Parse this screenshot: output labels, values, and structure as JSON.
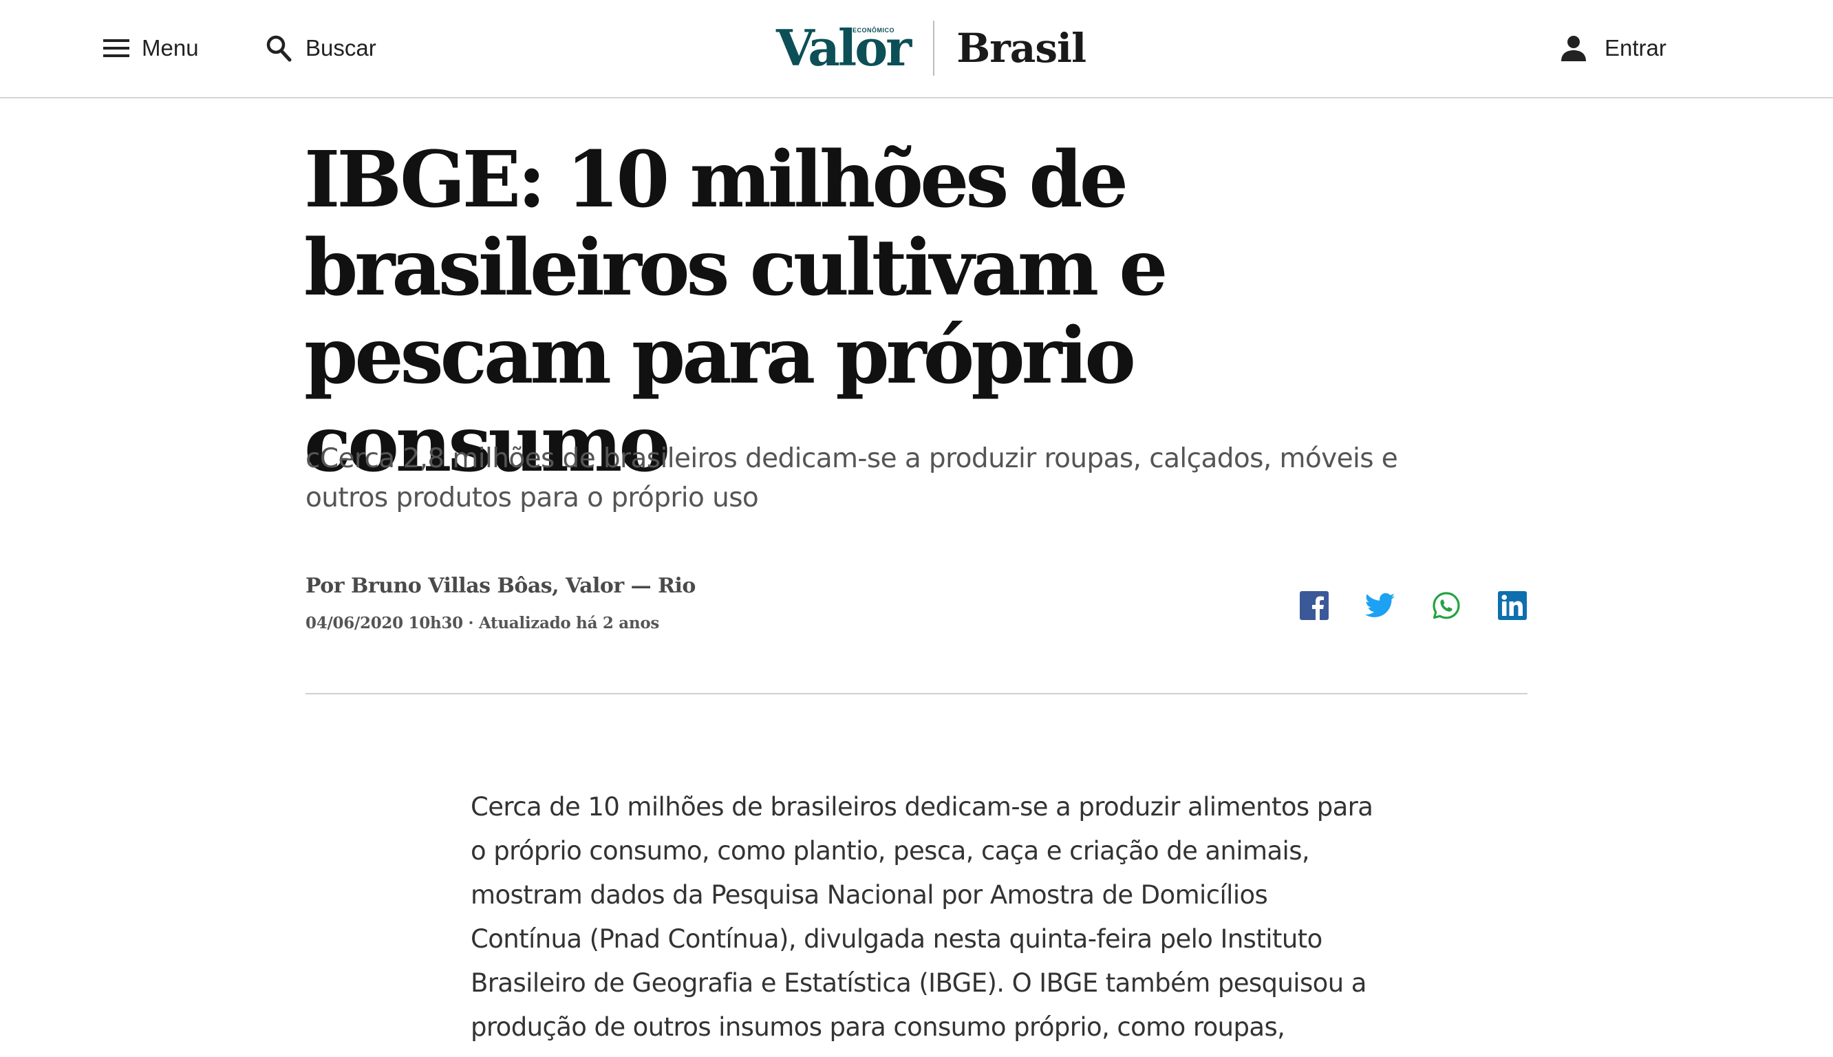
{
  "header": {
    "menu_label": "Menu",
    "menu_icon": "hamburger-icon",
    "search_label": "Buscar",
    "search_icon": "magnifier-icon",
    "logo_text": "Valor",
    "logo_super": "ECONÔMICO",
    "section_name": "Brasil",
    "login_label": "Entrar",
    "login_icon": "person-icon"
  },
  "article": {
    "headline": "IBGE: 10 milhões de brasileiros cultivam e pescam para próprio consumo",
    "subtitle": "cCerca 2,8 milhões de brasileiros dedicam-se a produzir roupas, calçados, móveis e outros produtos para o próprio uso",
    "byline": "Por Bruno Villas Bôas, Valor — Rio",
    "dateline": "04/06/2020 10h30 · Atualizado há 2 anos",
    "body": "Cerca de 10 milhões de brasileiros dedicam-se a produzir alimentos para o próprio consumo, como plantio, pesca, caça e criação de animais, mostram dados da Pesquisa Nacional por Amostra de Domicílios Contínua (Pnad Contínua), divulgada nesta quinta-feira pelo Instituto Brasileiro de Geografia e Estatística (IBGE). O IBGE também pesquisou a produção de outros insumos para consumo próprio, como roupas,"
  },
  "share": [
    {
      "network": "facebook",
      "icon": "facebook-icon",
      "color": "#3b5998"
    },
    {
      "network": "twitter",
      "icon": "twitter-icon",
      "color": "#1da1f2"
    },
    {
      "network": "whatsapp",
      "icon": "whatsapp-icon",
      "color": "#25a244"
    },
    {
      "network": "linkedin",
      "icon": "linkedin-icon",
      "color": "#0e6fae"
    }
  ],
  "colors": {
    "brand": "#0c4f57",
    "headline": "#111111",
    "subtitle": "#555555",
    "body": "#333333",
    "rule": "#cfcfcf"
  }
}
